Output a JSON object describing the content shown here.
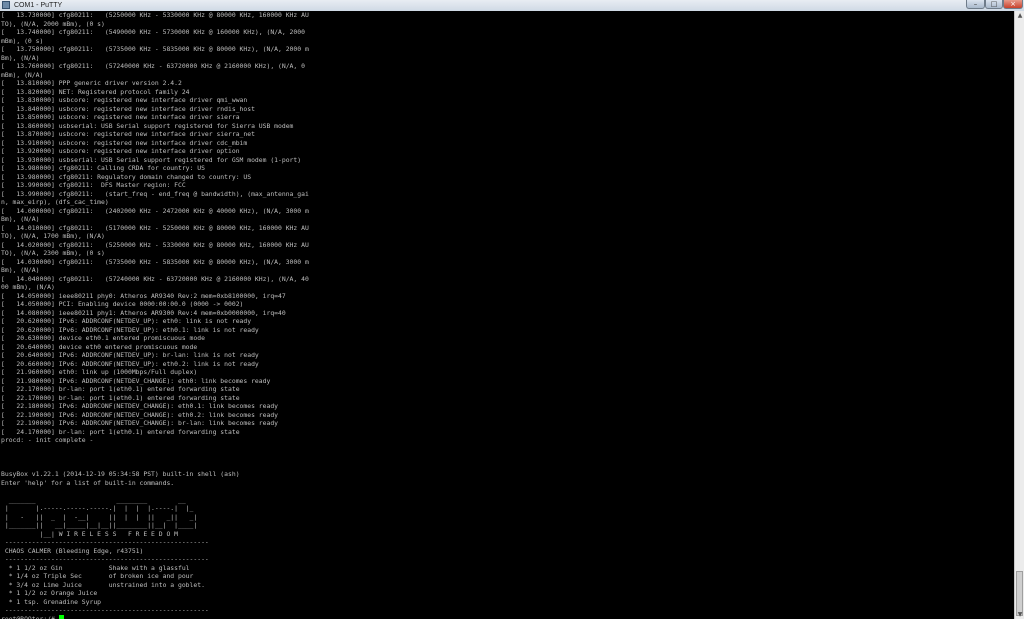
{
  "window": {
    "title": "COM1 - PuTTY",
    "min_symbol": "–",
    "max_symbol": "□",
    "close_symbol": "×"
  },
  "terminal": {
    "text_color": "#bfbfbf",
    "background": "#000000",
    "cursor_color": "#00ff00",
    "lines": [
      "[   13.730000] cfg80211:   (5250000 KHz - 5330000 KHz @ 80000 KHz, 160000 KHz AU",
      "TO), (N/A, 2000 mBm), (0 s)",
      "[   13.740000] cfg80211:   (5490000 KHz - 5730000 KHz @ 160000 KHz), (N/A, 2000",
      "mBm), (0 s)",
      "[   13.750000] cfg80211:   (5735000 KHz - 5835000 KHz @ 80000 KHz), (N/A, 2000 m",
      "Bm), (N/A)",
      "[   13.760000] cfg80211:   (57240000 KHz - 63720000 KHz @ 2160000 KHz), (N/A, 0",
      "mBm), (N/A)",
      "[   13.810000] PPP generic driver version 2.4.2",
      "[   13.820000] NET: Registered protocol family 24",
      "[   13.830000] usbcore: registered new interface driver qmi_wwan",
      "[   13.840000] usbcore: registered new interface driver rndis_host",
      "[   13.850000] usbcore: registered new interface driver sierra",
      "[   13.860000] usbserial: USB Serial support registered for Sierra USB modem",
      "[   13.870000] usbcore: registered new interface driver sierra_net",
      "[   13.910000] usbcore: registered new interface driver cdc_mbim",
      "[   13.920000] usbcore: registered new interface driver option",
      "[   13.930000] usbserial: USB Serial support registered for GSM modem (1-port)",
      "[   13.980000] cfg80211: Calling CRDA for country: US",
      "[   13.980000] cfg80211: Regulatory domain changed to country: US",
      "[   13.990000] cfg80211:  DFS Master region: FCC",
      "[   13.990000] cfg80211:   (start_freq - end_freq @ bandwidth), (max_antenna_gai",
      "n, max_eirp), (dfs_cac_time)",
      "[   14.000000] cfg80211:   (2402000 KHz - 2472000 KHz @ 40000 KHz), (N/A, 3000 m",
      "Bm), (N/A)",
      "[   14.010000] cfg80211:   (5170000 KHz - 5250000 KHz @ 80000 KHz, 160000 KHz AU",
      "TO), (N/A, 1700 mBm), (N/A)",
      "[   14.020000] cfg80211:   (5250000 KHz - 5330000 KHz @ 80000 KHz, 160000 KHz AU",
      "TO), (N/A, 2300 mBm), (0 s)",
      "[   14.030000] cfg80211:   (5735000 KHz - 5835000 KHz @ 80000 KHz), (N/A, 3000 m",
      "Bm), (N/A)",
      "[   14.040000] cfg80211:   (57240000 KHz - 63720000 KHz @ 2160000 KHz), (N/A, 40",
      "00 mBm), (N/A)",
      "[   14.050000] ieee80211 phy0: Atheros AR9340 Rev:2 mem=0xb8100000, irq=47",
      "[   14.050000] PCI: Enabling device 0000:00:00.0 (0000 -> 0002)",
      "[   14.080000] ieee80211 phy1: Atheros AR9300 Rev:4 mem=0xb0000000, irq=40",
      "[   20.620000] IPv6: ADDRCONF(NETDEV_UP): eth0: link is not ready",
      "[   20.620000] IPv6: ADDRCONF(NETDEV_UP): eth0.1: link is not ready",
      "[   20.630000] device eth0.1 entered promiscuous mode",
      "[   20.640000] device eth0 entered promiscuous mode",
      "[   20.640000] IPv6: ADDRCONF(NETDEV_UP): br-lan: link is not ready",
      "[   20.660000] IPv6: ADDRCONF(NETDEV_UP): eth0.2: link is not ready",
      "[   21.960000] eth0: link up (1000Mbps/Full duplex)",
      "[   21.980000] IPv6: ADDRCONF(NETDEV_CHANGE): eth0: link becomes ready",
      "[   22.170000] br-lan: port 1(eth0.1) entered forwarding state",
      "[   22.170000] br-lan: port 1(eth0.1) entered forwarding state",
      "[   22.180000] IPv6: ADDRCONF(NETDEV_CHANGE): eth0.1: link becomes ready",
      "[   22.190000] IPv6: ADDRCONF(NETDEV_CHANGE): eth0.2: link becomes ready",
      "[   22.190000] IPv6: ADDRCONF(NETDEV_CHANGE): br-lan: link becomes ready",
      "[   24.170000] br-lan: port 1(eth0.1) entered forwarding state",
      "procd: - init complete -",
      "",
      "",
      "",
      "BusyBox v1.22.1 (2014-12-19 05:34:58 PST) built-in shell (ash)",
      "Enter 'help' for a list of built-in commands.",
      "",
      "  _______                     ________        __",
      " |       |.-----.-----.-----.|  |  |  |.----.|  |_",
      " |   -   ||  _  |  -__|     ||  |  |  ||   _||   _|",
      " |_______||   __|_____|__|__||________||__|  |____|",
      "          |__| W I R E L E S S   F R E E D O M",
      " -----------------------------------------------------",
      " CHAOS CALMER (Bleeding Edge, r43751)",
      " -----------------------------------------------------",
      "  * 1 1/2 oz Gin            Shake with a glassful",
      "  * 1/4 oz Triple Sec       of broken ice and pour",
      "  * 3/4 oz Lime Juice       unstrained into a goblet.",
      "  * 1 1/2 oz Orange Juice",
      "  * 1 tsp. Grenadine Syrup",
      " -----------------------------------------------------"
    ],
    "prompt": "root@ROOter:/# "
  }
}
